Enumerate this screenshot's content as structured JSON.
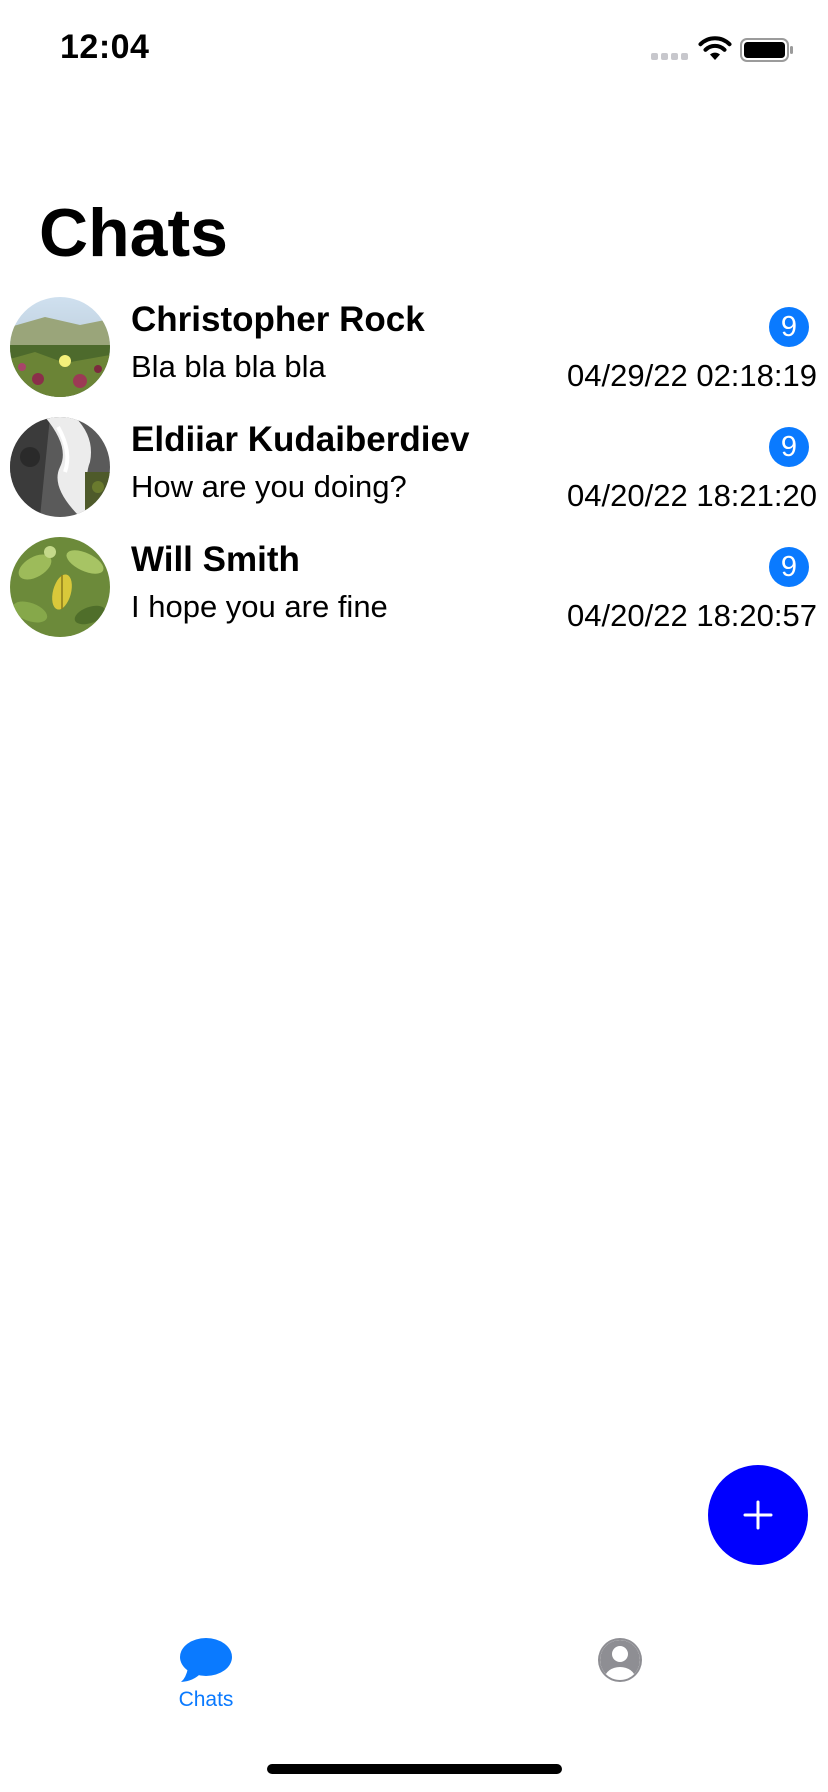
{
  "status_bar": {
    "time": "12:04"
  },
  "header": {
    "title": "Chats"
  },
  "chats": [
    {
      "name": "Christopher Rock",
      "message": "Bla bla bla bla",
      "unread": "9",
      "timestamp": "04/29/22 02:18:19"
    },
    {
      "name": "Eldiiar Kudaiberdiev",
      "message": "How are you doing?",
      "unread": "9",
      "timestamp": "04/20/22 18:21:20"
    },
    {
      "name": "Will Smith",
      "message": "I hope you are fine",
      "unread": "9",
      "timestamp": "04/20/22 18:20:57"
    }
  ],
  "fab": {
    "icon": "plus-icon"
  },
  "tab_bar": {
    "items": [
      {
        "label": "Chats",
        "icon": "chat-bubble-icon",
        "active": true
      },
      {
        "label": "",
        "icon": "person-circle-icon",
        "active": false
      }
    ]
  },
  "colors": {
    "accent": "#0a7aff",
    "fab": "#0000ff",
    "inactive_tab": "#8e8e93"
  }
}
